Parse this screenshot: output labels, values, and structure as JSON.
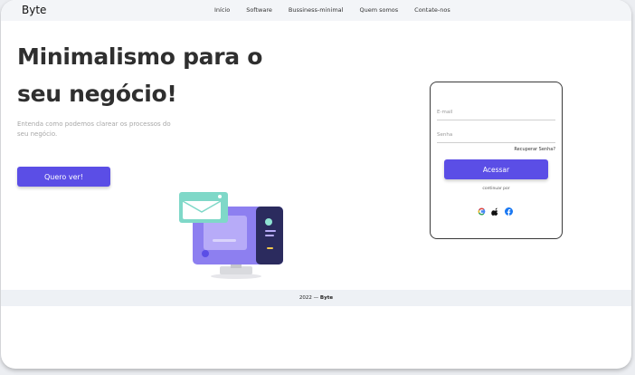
{
  "header": {
    "brand": "Byte",
    "nav": [
      "Início",
      "Software",
      "Bussiness-minimal",
      "Quem somos",
      "Contate-nos"
    ]
  },
  "hero": {
    "title": "Minimalismo para o seu negócio!",
    "subtitle": "Entenda como podemos clarear os processos do seu negócio.",
    "cta_label": "Quero ver!"
  },
  "login": {
    "email_placeholder": "E-mail",
    "password_placeholder": "Senha",
    "forgot_label": "Recuperar Senha?",
    "submit_label": "Acessar",
    "continue_label": "continuar por",
    "providers": [
      "google-icon",
      "apple-icon",
      "facebook-icon"
    ]
  },
  "footer": {
    "year_text": "2022 —",
    "brand": "Byte"
  },
  "colors": {
    "accent": "#5b4ee6",
    "topbar_bg": "#f3f5f8",
    "footer_bg": "#eef1f5"
  }
}
